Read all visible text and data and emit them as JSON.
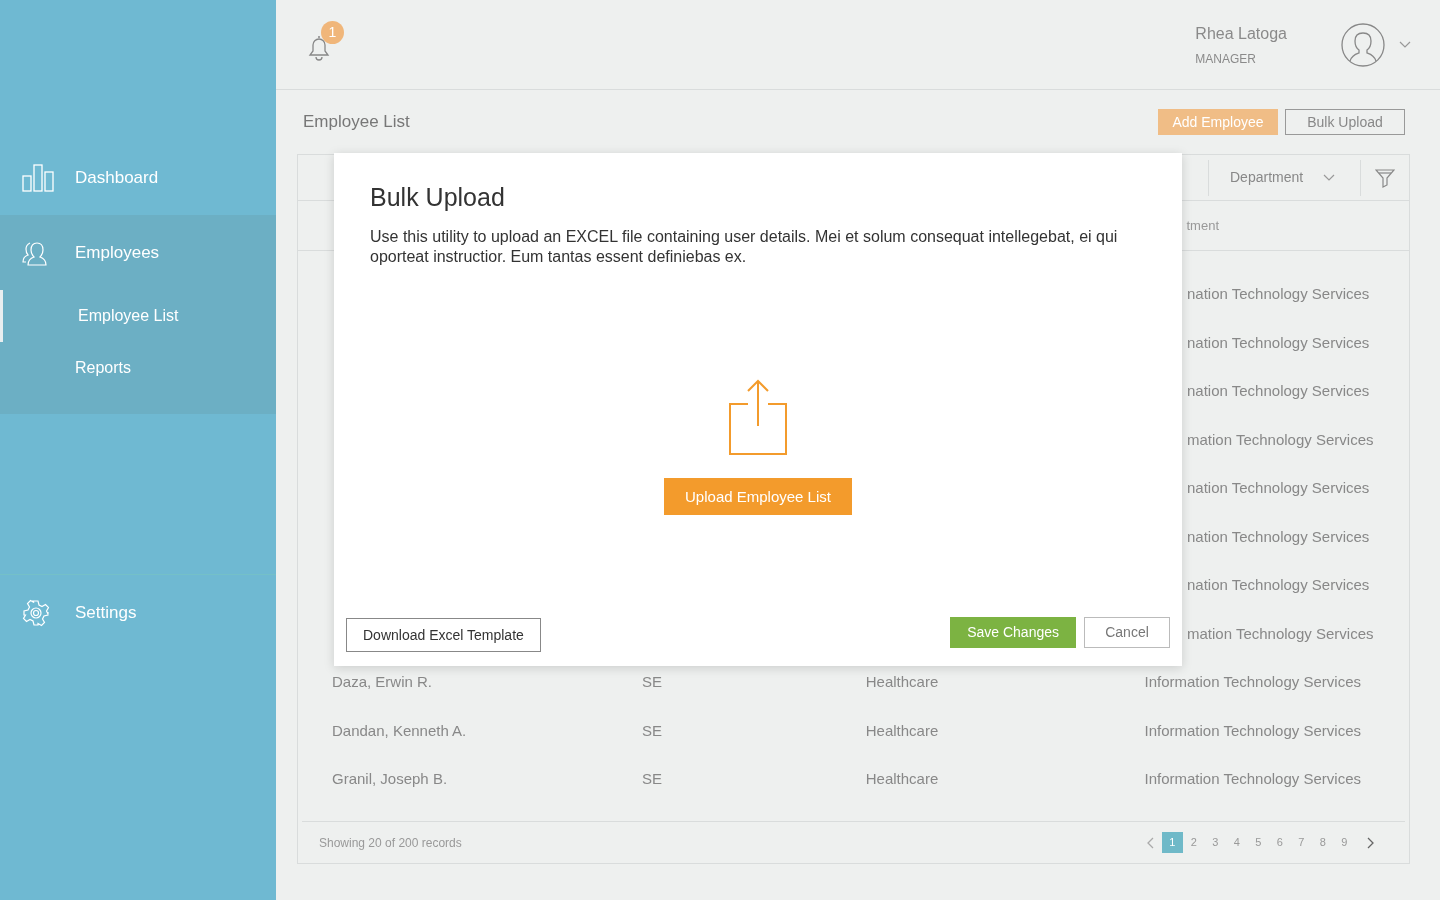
{
  "header": {
    "notification_count": "1",
    "user_name": "Rhea Latoga",
    "user_role": "MANAGER"
  },
  "sidebar": {
    "items": [
      {
        "label": "Dashboard"
      },
      {
        "label": "Employees",
        "children": [
          {
            "label": "Employee List",
            "selected": true
          },
          {
            "label": "Reports",
            "selected": false
          }
        ]
      },
      {
        "label": "Settings"
      }
    ]
  },
  "page": {
    "title": "Employee List",
    "actions": [
      {
        "label": "Add Employee",
        "kind": "primary"
      },
      {
        "label": "Bulk Upload",
        "kind": "outline"
      }
    ]
  },
  "table": {
    "filter": "Department",
    "column_4": "tment",
    "rows": [
      {
        "department": "nation Technology Services"
      },
      {
        "department": "nation Technology Services"
      },
      {
        "department": "nation Technology Services"
      },
      {
        "department": "mation Technology Services"
      },
      {
        "department": "nation Technology Services"
      },
      {
        "department": "nation Technology Services"
      },
      {
        "department": "nation Technology Services"
      },
      {
        "department": "mation Technology Services"
      },
      {
        "name": "Daza, Erwin R.",
        "code": "SE",
        "industry": "Healthcare",
        "department": "Information Technology Services"
      },
      {
        "name": "Dandan, Kenneth A.",
        "code": "SE",
        "industry": "Healthcare",
        "department": "Information Technology Services"
      },
      {
        "name": "Granil, Joseph B.",
        "code": "SE",
        "industry": "Healthcare",
        "department": "Information Technology Services"
      }
    ],
    "footer": "Showing 20 of 200 records",
    "pages": [
      {
        "label": "1",
        "selected": true
      },
      {
        "label": "2",
        "selected": false
      },
      {
        "label": "3",
        "selected": false
      },
      {
        "label": "4",
        "selected": false
      },
      {
        "label": "5",
        "selected": false
      },
      {
        "label": "6",
        "selected": false
      },
      {
        "label": "7",
        "selected": false
      },
      {
        "label": "8",
        "selected": false
      },
      {
        "label": "9",
        "selected": false
      }
    ]
  },
  "modal": {
    "title": "Bulk Upload",
    "text": "Use this utility to upload an EXCEL file containing user details. Mei et solum consequat intellegebat, ei qui oporteat instructior. Eum tantas essent definiebas ex.",
    "upload_button": "Upload Employee List",
    "download_button": "Download Excel Template",
    "save_button": "Save Changes",
    "cancel_button": "Cancel"
  }
}
